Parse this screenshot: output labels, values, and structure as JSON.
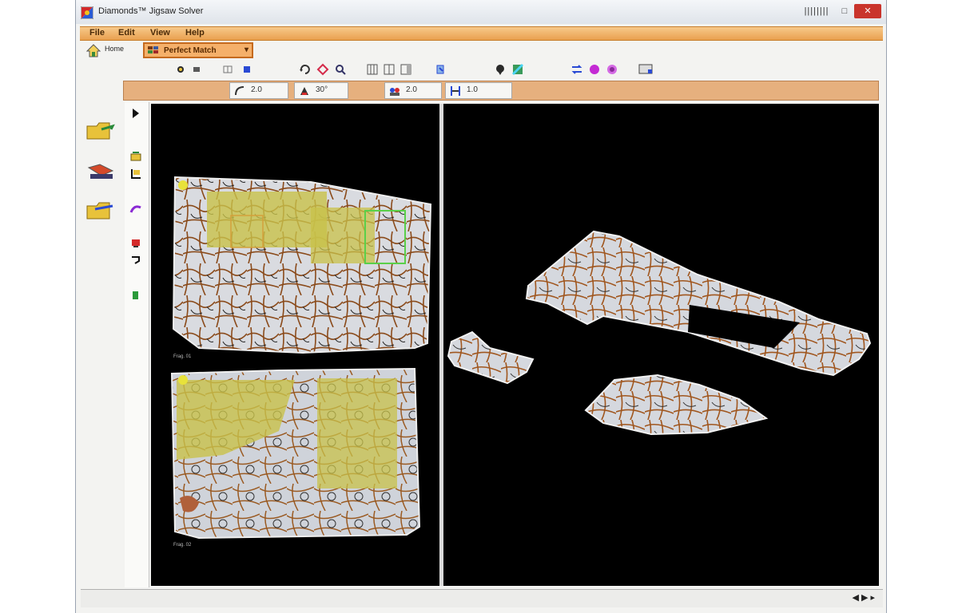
{
  "window": {
    "title": "Diamonds™ Jigsaw Solver",
    "controls": [
      "_",
      "□",
      "✕"
    ]
  },
  "menu": [
    "File",
    "Edit",
    "View",
    "Help"
  ],
  "toolbar": {
    "home_label": "Home",
    "mode_label": "Perfect Match",
    "mode_arrow": "▾"
  },
  "properties": {
    "angle": "2.0",
    "tilt": "30°",
    "count": "2.0",
    "size": "1.0"
  },
  "views": {
    "left": {
      "caption_top": "Frag. 01",
      "caption_bottom": "Frag. 02"
    }
  },
  "statusbar": {
    "nav": "◀ ▶ ▸"
  },
  "colors": {
    "menubar": "#e9a04f",
    "mode_select": "#f5b06a",
    "property_bar": "#e6b07e",
    "canvas": "#000000"
  }
}
